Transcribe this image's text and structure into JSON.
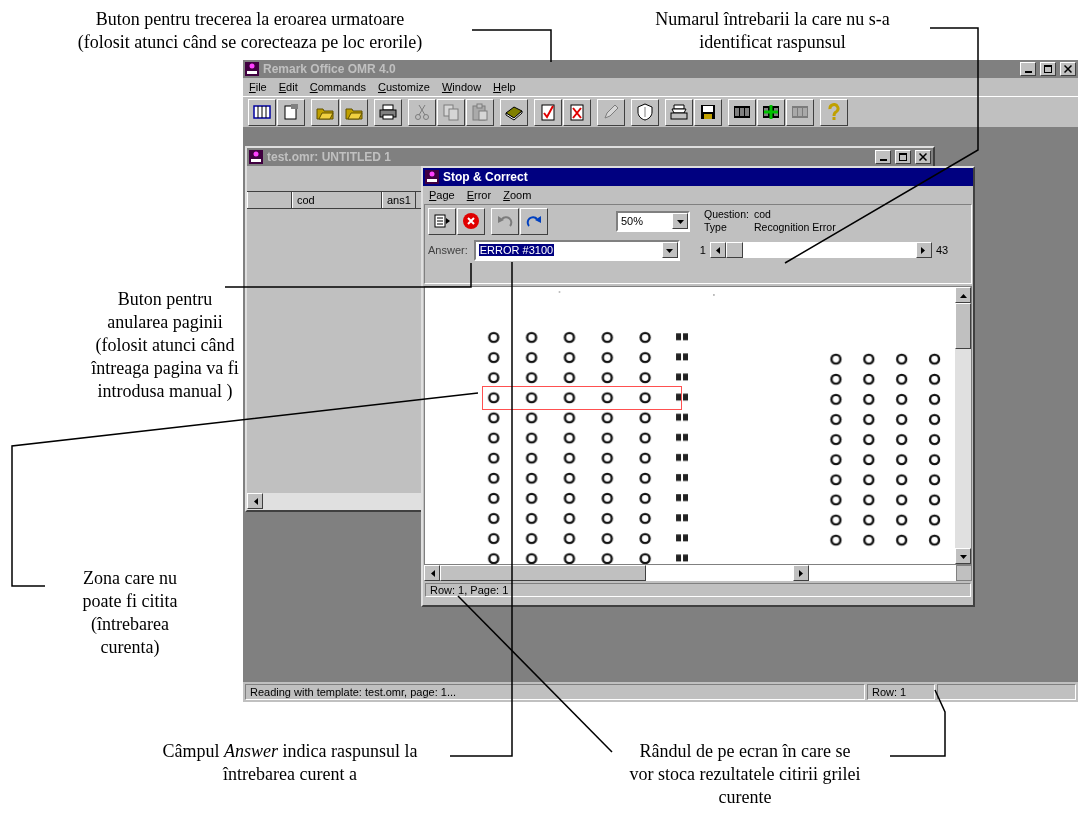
{
  "annotations": [
    {
      "lines": [
        "Buton pentru trecerea la eroarea urmatoare",
        "(folosit atunci când se corecteaza pe loc erorile)"
      ]
    },
    {
      "lines": [
        "Numarul întrebarii la care nu s-a",
        "identificat raspunsul"
      ]
    },
    {
      "lines": [
        "Buton pentru",
        "anularea paginii",
        "(folosit atunci când",
        "întreaga pagina va fi",
        "introdusa manual )"
      ]
    },
    {
      "lines": [
        "Zona care nu",
        "poate fi citita",
        "(întrebarea",
        "curenta)"
      ]
    },
    {
      "lines": [
        "Câmpul *Answer* indica raspunsul la",
        "întrebarea curent a"
      ]
    },
    {
      "lines": [
        "Rândul de pe ecran în care se",
        "vor stoca rezultatele citirii grilei",
        "curente"
      ]
    }
  ],
  "app": {
    "title": "Remark Office OMR 4.0",
    "active": false,
    "menu": [
      "File",
      "Edit",
      "Commands",
      "Customize",
      "Window",
      "Help"
    ],
    "toolbar": [
      [
        {
          "kind": "grid",
          "disabled": false
        },
        {
          "kind": "props",
          "disabled": false
        }
      ],
      [
        {
          "kind": "open",
          "disabled": false
        },
        {
          "kind": "open",
          "disabled": false
        }
      ],
      [
        {
          "kind": "print",
          "disabled": false
        }
      ],
      [
        {
          "kind": "cut",
          "disabled": true
        },
        {
          "kind": "copy",
          "disabled": true
        },
        {
          "kind": "paste",
          "disabled": true
        }
      ],
      [
        {
          "kind": "book",
          "disabled": false
        }
      ],
      [
        {
          "kind": "check",
          "disabled": false
        },
        {
          "kind": "cross",
          "disabled": false
        }
      ],
      [
        {
          "kind": "pencil",
          "disabled": true
        }
      ],
      [
        {
          "kind": "shield",
          "disabled": false
        }
      ],
      [
        {
          "kind": "scanner",
          "disabled": false
        },
        {
          "kind": "save",
          "disabled": false
        }
      ],
      [
        {
          "kind": "barcode",
          "disabled": false
        },
        {
          "kind": "barcodeplus",
          "disabled": false
        },
        {
          "kind": "barcode",
          "disabled": true
        }
      ],
      [
        {
          "kind": "help",
          "disabled": false
        }
      ]
    ],
    "status_bar": [
      "Reading with template: test.omr, page: 1...",
      "Row: 1"
    ]
  },
  "document_window": {
    "title": "test.omr: UNTITLED 1",
    "active": false,
    "columns": [
      "cod",
      "ans1"
    ]
  },
  "dialog": {
    "title": "Stop & Correct",
    "active": true,
    "menu": [
      "Page",
      "Error",
      "Zoom"
    ],
    "buttons": [
      [
        {
          "kind": "nexterr",
          "disabled": false
        },
        {
          "kind": "cancel",
          "disabled": false
        }
      ],
      [
        {
          "kind": "undo",
          "disabled": true
        },
        {
          "kind": "redo",
          "disabled": false
        }
      ]
    ],
    "zoom": "50%",
    "question_label": "Question:",
    "question": "cod",
    "type_label": "Type",
    "type": "Recognition Error",
    "answer_label": "Answer:",
    "answer": "ERROR #3100",
    "answer_selected": true,
    "slider": {
      "min": "1",
      "max": "43",
      "level": 0
    },
    "image": {
      "kind": "picture"
    },
    "status": "Row: 1, Page: 1"
  }
}
